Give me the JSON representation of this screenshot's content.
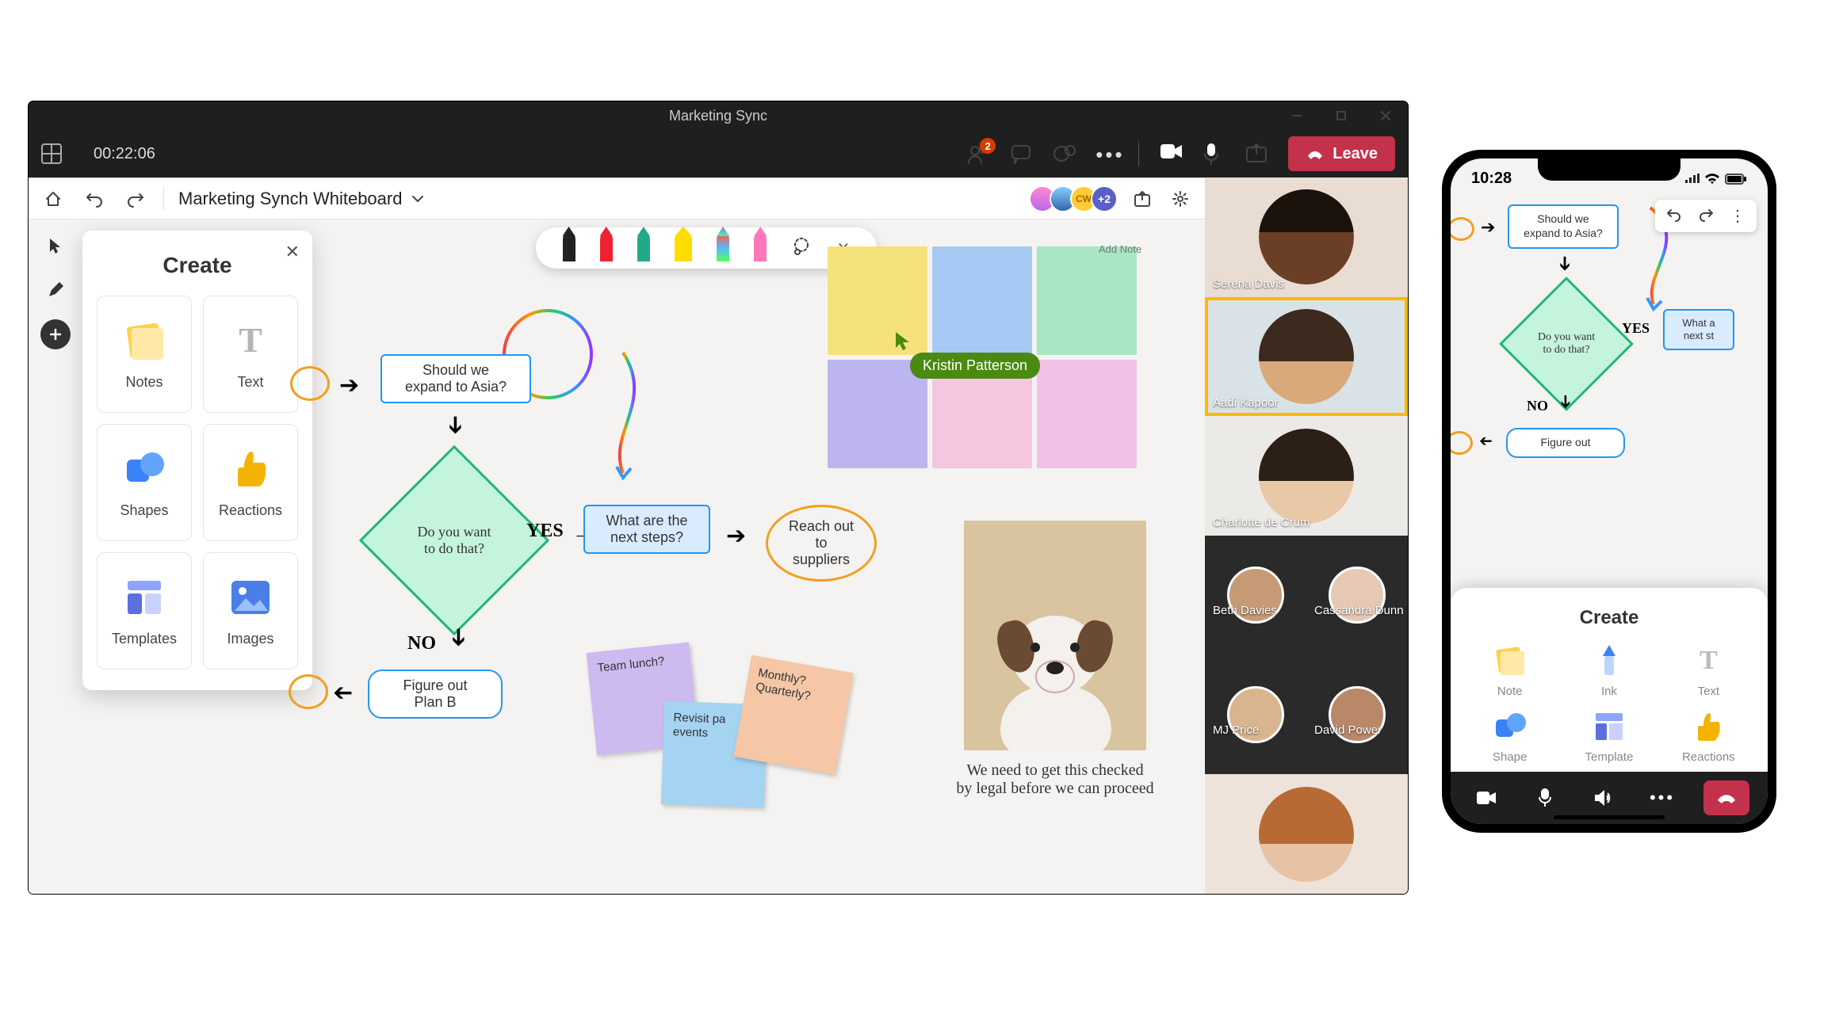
{
  "desktop": {
    "window_title": "Marketing Sync",
    "meeting": {
      "timer": "00:22:06",
      "people_badge": "2",
      "leave_label": "Leave"
    },
    "whiteboard": {
      "title": "Marketing Synch Whiteboard",
      "avatar_overflow": "+2",
      "create_panel_title": "Create",
      "create_items": [
        {
          "label": "Notes"
        },
        {
          "label": "Text"
        },
        {
          "label": "Shapes"
        },
        {
          "label": "Reactions"
        },
        {
          "label": "Templates"
        },
        {
          "label": "Images"
        }
      ],
      "palette_label": "Add Note",
      "cursor_user": "Kristin Patterson",
      "flow": {
        "box1": "Should we\nexpand to Asia?",
        "diamond": "Do you want\nto do that?",
        "yes": "YES",
        "no": "NO",
        "box_steps": "What are the\nnext steps?",
        "oval_suppliers": "Reach out to\nsuppliers",
        "box_planb": "Figure out\nPlan B"
      },
      "stickies": {
        "purple": "Team lunch?",
        "blue": "Revisit pa\nevents",
        "orange": "Monthly?\nQuarterly?"
      },
      "caption": "We need to get this checked\nby legal before we can proceed"
    },
    "participants": [
      {
        "name": "Serena Davis"
      },
      {
        "name": "Aadi Kapoor"
      },
      {
        "name": "Charlotte de Crum"
      },
      {
        "name": "Beth Davies"
      },
      {
        "name": "Cassandra Dunn"
      },
      {
        "name": "MJ Price"
      },
      {
        "name": "David Power"
      }
    ]
  },
  "mobile": {
    "time": "10:28",
    "flow": {
      "box1": "Should we\nexpand to Asia?",
      "diamond": "Do you want\nto do that?",
      "yes": "YES",
      "no": "NO",
      "box_steps": "What a\nnext st",
      "box_planb": "Figure out"
    },
    "create_title": "Create",
    "create_items": [
      {
        "label": "Note"
      },
      {
        "label": "Ink"
      },
      {
        "label": "Text"
      },
      {
        "label": "Shape"
      },
      {
        "label": "Template"
      },
      {
        "label": "Reactions"
      }
    ]
  },
  "colors": {
    "leave": "#c4314b",
    "accent": "#5b5fc7",
    "green": "#1db877",
    "blue": "#2196f3",
    "orange": "#f0a020"
  }
}
